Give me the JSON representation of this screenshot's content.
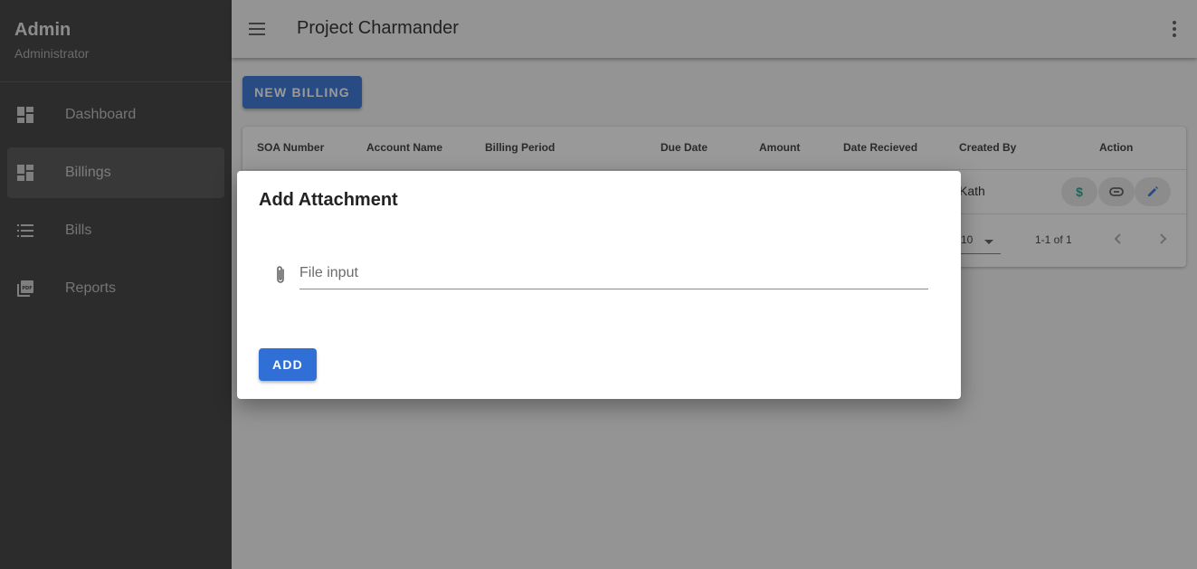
{
  "sidebar": {
    "user_name": "Admin",
    "user_role": "Administrator",
    "items": [
      {
        "label": "Dashboard",
        "icon": "dashboard-icon"
      },
      {
        "label": "Billings",
        "icon": "dashboard-icon",
        "active": true
      },
      {
        "label": "Bills",
        "icon": "list-icon"
      },
      {
        "label": "Reports",
        "icon": "pdf-icon"
      }
    ]
  },
  "appbar": {
    "title": "Project Charmander",
    "menu_icon": "hamburger-menu-icon",
    "more_icon": "more-vert-icon"
  },
  "toolbar": {
    "new_billing_label": "NEW BILLING"
  },
  "table": {
    "headers": [
      "SOA Number",
      "Account Name",
      "Billing Period",
      "Due Date",
      "Amount",
      "Date Recieved",
      "Created By",
      "Action"
    ],
    "rows": [
      {
        "created_by": "Kath",
        "actions": [
          "dollar-icon",
          "link-icon",
          "pencil-icon"
        ]
      }
    ],
    "rows_per_page": "10",
    "page_info": "1-1 of 1"
  },
  "dialog": {
    "title": "Add Attachment",
    "file_placeholder": "File input",
    "add_label": "ADD"
  },
  "colors": {
    "primary": "#2f6fd6",
    "sidebar": "#363636",
    "dollar_icon": "#1a9e8a"
  }
}
